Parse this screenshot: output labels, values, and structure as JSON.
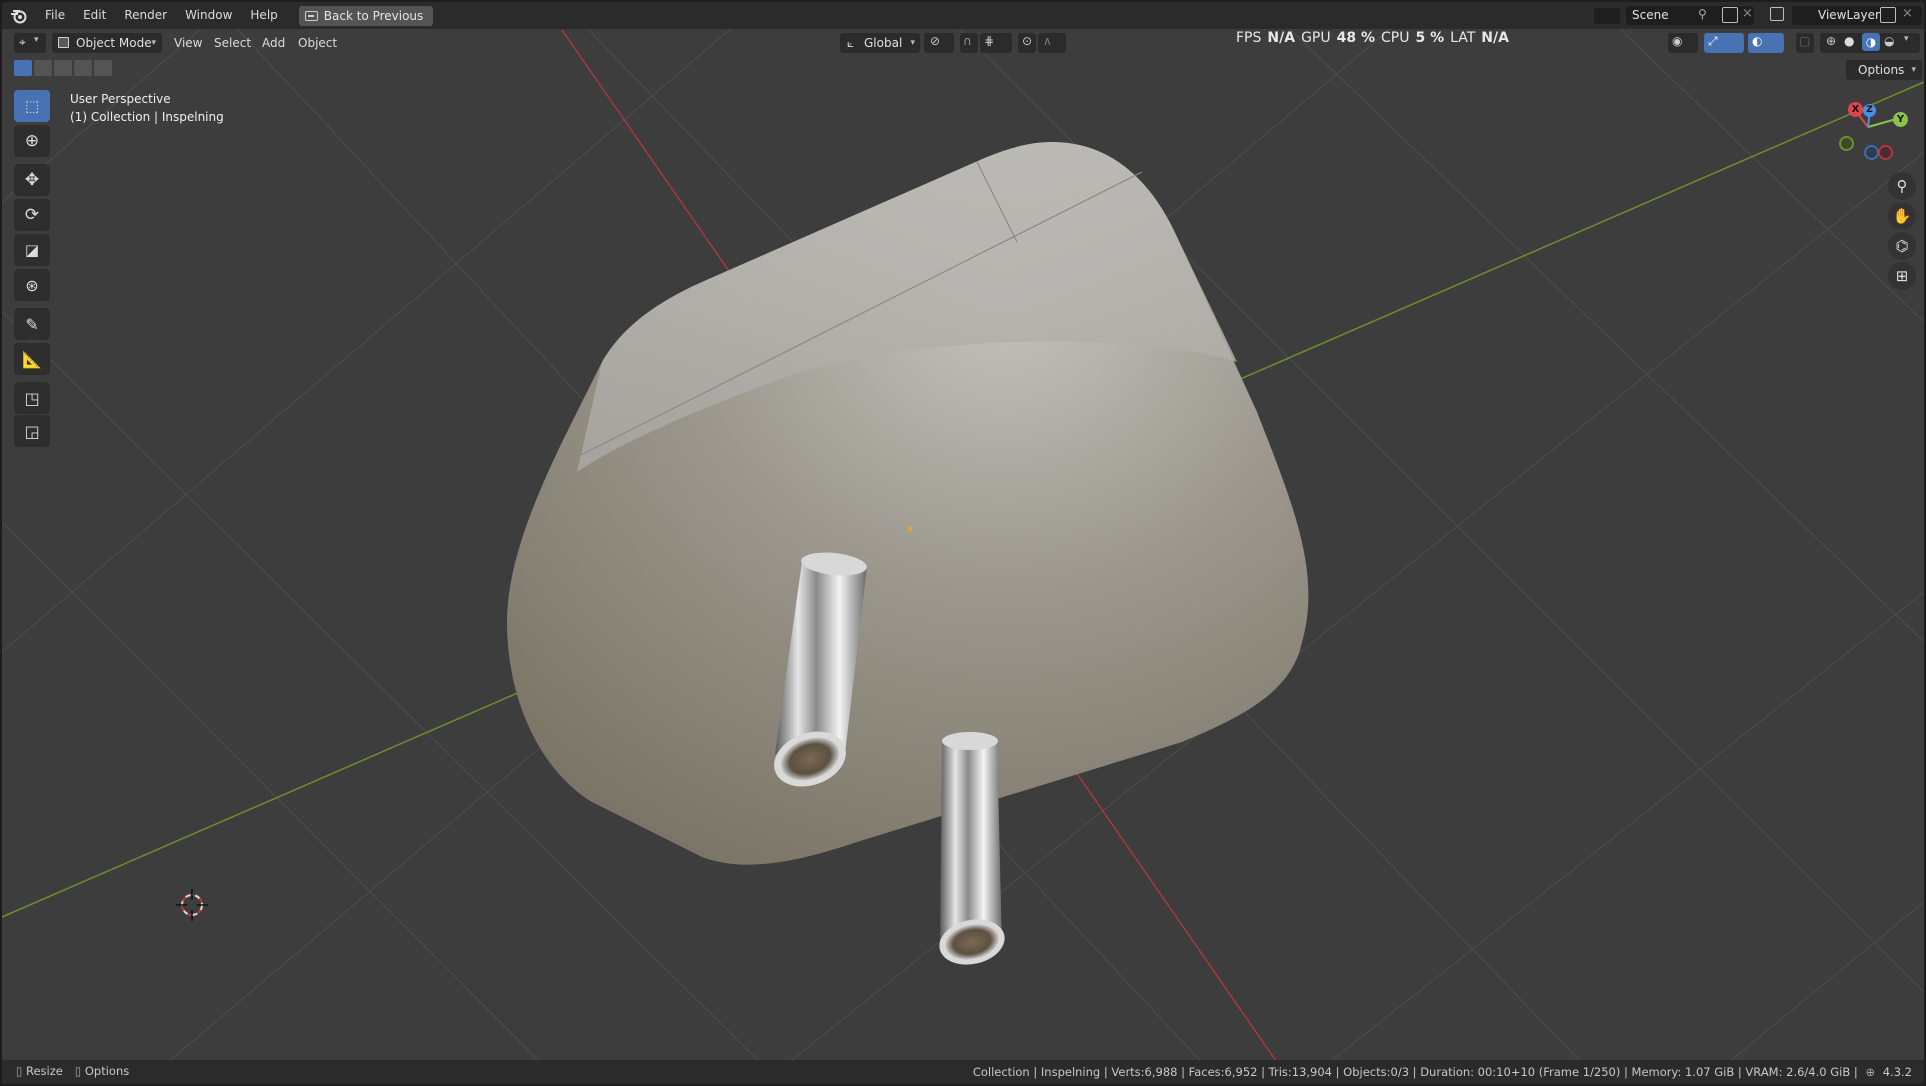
{
  "menu": {
    "items": [
      "File",
      "Edit",
      "Render",
      "Window",
      "Help"
    ],
    "back_to_previous": "Back to Previous"
  },
  "scene": {
    "name": "Scene"
  },
  "viewlayer": {
    "name": "ViewLayer"
  },
  "viewport_header": {
    "mode": "Object Mode",
    "menus": [
      "View",
      "Select",
      "Add",
      "Object"
    ],
    "orientation": "Global"
  },
  "stats": {
    "fps_label": "FPS",
    "fps_value": "N/A",
    "gpu_label": "GPU",
    "gpu_value": "48 %",
    "cpu_label": "CPU",
    "cpu_value": "5 %",
    "lat_label": "LAT",
    "lat_value": "N/A"
  },
  "options_label": "Options",
  "view_info": {
    "perspective": "User Perspective",
    "collection": "(1) Collection | Inspelning"
  },
  "gizmo": {
    "x": "X",
    "y": "Y",
    "z": "Z"
  },
  "statusbar": {
    "left_action": "Resize",
    "left_options": "Options",
    "right": "Collection | Inspelning | Verts:6,988 | Faces:6,952 | Tris:13,904 | Objects:0/3 | Duration: 00:10+10 (Frame 1/250) | Memory: 1.07 GiB | VRAM: 2.6/4.0 GiB |",
    "version": "4.3.2"
  },
  "colors": {
    "accent": "#4772b3",
    "x_axis": "#e0444e",
    "y_axis": "#8bc34a",
    "z_axis": "#4a90e2"
  }
}
